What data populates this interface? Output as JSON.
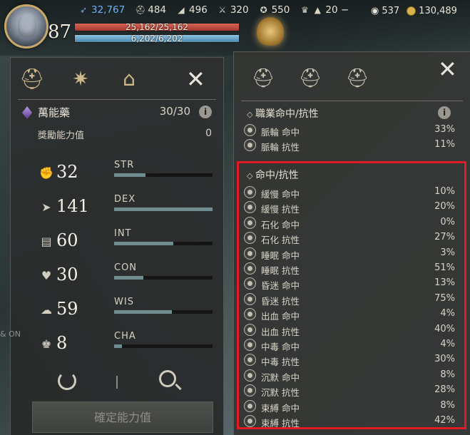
{
  "hud": {
    "level": "87",
    "stats": [
      {
        "icon": "feather-icon",
        "value": "32,767"
      },
      {
        "icon": "helmet-icon",
        "value": "484"
      },
      {
        "icon": "boot-icon",
        "value": "496"
      },
      {
        "icon": "crossed-swords-icon",
        "value": "320"
      },
      {
        "icon": "medal-icon",
        "value": "550"
      },
      {
        "icon": "trophy-icon",
        "value": ""
      },
      {
        "icon": "triangle-emblem-icon",
        "value": "20 −"
      }
    ],
    "hp_text": "25,162/25,162",
    "hp_fraction": 1.0,
    "mp_text": "6,202/6,202",
    "mp_fraction": 1.0,
    "right_stats": [
      {
        "icon": "eye-icon",
        "value": "537"
      },
      {
        "icon": "coin-icon",
        "value": "130,489"
      }
    ]
  },
  "left_panel": {
    "close_label": "✕",
    "potion_name": "萬能藥",
    "potion_count": "30/30",
    "info_label": "i",
    "bonus_label": "獎勵能力值",
    "bonus_value": "0",
    "attributes": [
      {
        "icon": "muscle-icon",
        "value": "32",
        "name": "STR",
        "fill": 0.32
      },
      {
        "icon": "dash-icon",
        "value": "141",
        "name": "DEX",
        "fill": 1.0
      },
      {
        "icon": "book-icon",
        "value": "60",
        "name": "INT",
        "fill": 0.6
      },
      {
        "icon": "heart-icon",
        "value": "30",
        "name": "CON",
        "fill": 0.3
      },
      {
        "icon": "brain-icon",
        "value": "59",
        "name": "WIS",
        "fill": 0.59
      },
      {
        "icon": "crown-icon",
        "value": "8",
        "name": "CHA",
        "fill": 0.08
      }
    ],
    "confirm_label": "確定能力值"
  },
  "right_panel": {
    "close_label": "✕",
    "class_section_title": "職業命中/抗性",
    "class_rows": [
      {
        "label": "脈輪 命中",
        "value": "33%"
      },
      {
        "label": "脈輪 抗性",
        "value": "11%"
      }
    ],
    "hit_section_title": "命中/抗性",
    "hit_rows": [
      {
        "label": "緩慢 命中",
        "value": "10%"
      },
      {
        "label": "緩慢 抗性",
        "value": "20%"
      },
      {
        "label": "石化 命中",
        "value": "0%"
      },
      {
        "label": "石化 抗性",
        "value": "27%"
      },
      {
        "label": "睡眠 命中",
        "value": "3%"
      },
      {
        "label": "睡眠 抗性",
        "value": "51%"
      },
      {
        "label": "昏迷 命中",
        "value": "13%"
      },
      {
        "label": "昏迷 抗性",
        "value": "75%"
      },
      {
        "label": "出血 命中",
        "value": "4%"
      },
      {
        "label": "出血 抗性",
        "value": "40%"
      },
      {
        "label": "中毒 命中",
        "value": "4%"
      },
      {
        "label": "中毒 抗性",
        "value": "30%"
      },
      {
        "label": "沉默 命中",
        "value": "8%"
      },
      {
        "label": "沉默 抗性",
        "value": "28%"
      },
      {
        "label": "束縛 命中",
        "value": "8%"
      },
      {
        "label": "束縛 抗性",
        "value": "42%"
      }
    ]
  },
  "world": {
    "npc_label": "",
    "side_label": "& ON"
  }
}
